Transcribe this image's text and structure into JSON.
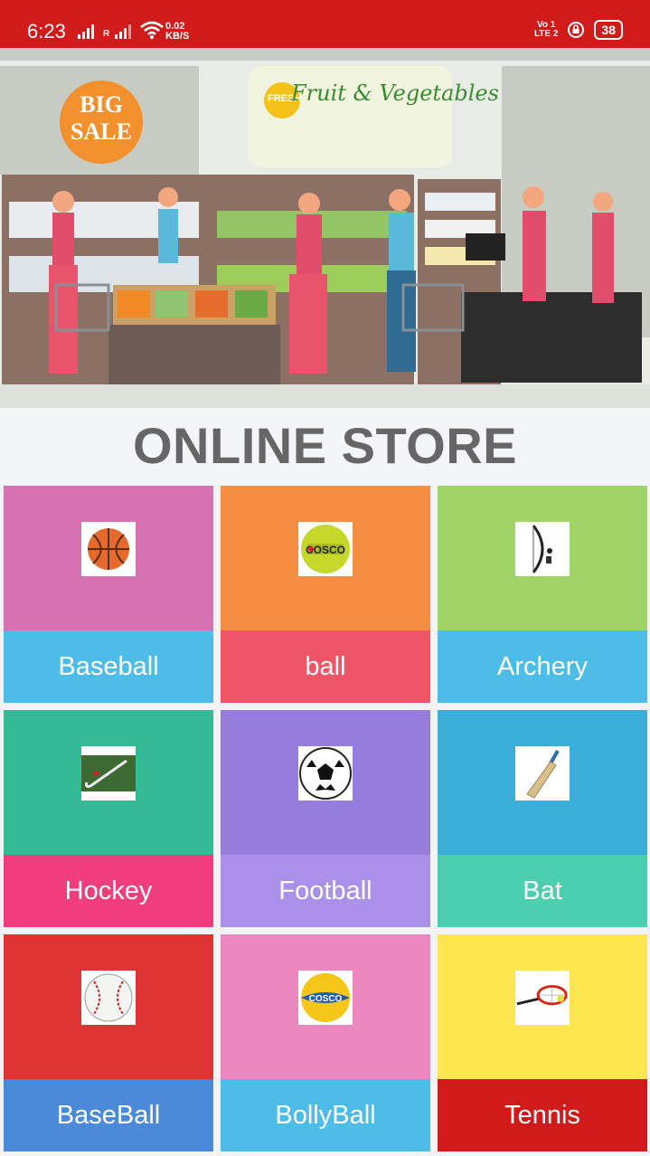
{
  "status_bar": {
    "time": "6:23",
    "net_speed_value": "0.02",
    "net_speed_unit": "KB/S",
    "volte_top": "Vo 1",
    "volte_bottom": "LTE 2",
    "battery": "38",
    "signal_label": "R"
  },
  "banner": {
    "sale_line1": "BIG",
    "sale_line2": "SALE",
    "section_sign": "Fruit & Vegetables",
    "fresh_badge": "FRESH"
  },
  "page": {
    "title": "ONLINE STORE"
  },
  "tiles": [
    {
      "label": "Baseball",
      "icon": "basketball-icon",
      "top_color": "#d672b1",
      "bottom_color": "#4dbde8"
    },
    {
      "label": "ball",
      "icon": "cricket-ball-icon",
      "top_color": "#f58d42",
      "bottom_color": "#ee5566"
    },
    {
      "label": "Archery",
      "icon": "compound-bow-icon",
      "top_color": "#a1d467",
      "bottom_color": "#4dbde8"
    },
    {
      "label": "Hockey",
      "icon": "hockey-stick-icon",
      "top_color": "#33b995",
      "bottom_color": "#f03d7c"
    },
    {
      "label": "Football",
      "icon": "soccer-ball-icon",
      "top_color": "#967cdc",
      "bottom_color": "#ab90ea"
    },
    {
      "label": "Bat",
      "icon": "cricket-bat-icon",
      "top_color": "#3aadd9",
      "bottom_color": "#4bcfae"
    },
    {
      "label": "BaseBall",
      "icon": "baseball-icon",
      "top_color": "#df3434",
      "bottom_color": "#4b89d9"
    },
    {
      "label": "BollyBall",
      "icon": "volleyball-icon",
      "top_color": "#eb87bf",
      "bottom_color": "#4dbde8"
    },
    {
      "label": "Tennis",
      "icon": "tennis-racket-icon",
      "top_color": "#fce54e",
      "bottom_color": "#d11a1a"
    }
  ]
}
